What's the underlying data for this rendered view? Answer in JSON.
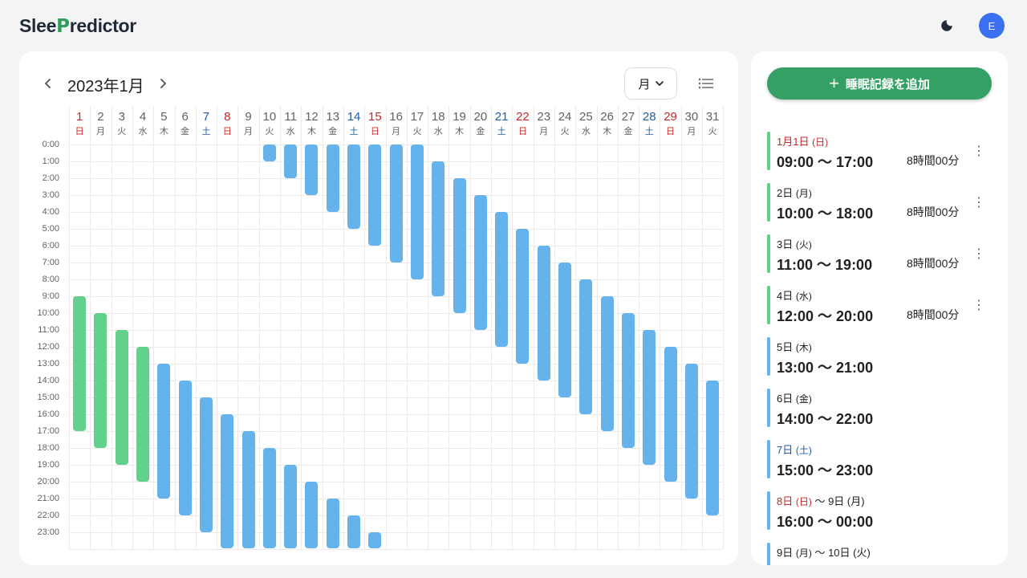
{
  "app": {
    "logo_prefix": "Slee",
    "logo_p": "P",
    "logo_suffix": "redictor",
    "avatar_initial": "E",
    "theme_icon": "moon-icon"
  },
  "calendar": {
    "month_title": "2023年1月",
    "view_label": "月",
    "days": [
      {
        "d": "1",
        "w": "日"
      },
      {
        "d": "2",
        "w": "月"
      },
      {
        "d": "3",
        "w": "火"
      },
      {
        "d": "4",
        "w": "水"
      },
      {
        "d": "5",
        "w": "木"
      },
      {
        "d": "6",
        "w": "金"
      },
      {
        "d": "7",
        "w": "土"
      },
      {
        "d": "8",
        "w": "日"
      },
      {
        "d": "9",
        "w": "月"
      },
      {
        "d": "10",
        "w": "火"
      },
      {
        "d": "11",
        "w": "水"
      },
      {
        "d": "12",
        "w": "木"
      },
      {
        "d": "13",
        "w": "金"
      },
      {
        "d": "14",
        "w": "土"
      },
      {
        "d": "15",
        "w": "日"
      },
      {
        "d": "16",
        "w": "月"
      },
      {
        "d": "17",
        "w": "火"
      },
      {
        "d": "18",
        "w": "水"
      },
      {
        "d": "19",
        "w": "木"
      },
      {
        "d": "20",
        "w": "金"
      },
      {
        "d": "21",
        "w": "土"
      },
      {
        "d": "22",
        "w": "日"
      },
      {
        "d": "23",
        "w": "月"
      },
      {
        "d": "24",
        "w": "火"
      },
      {
        "d": "25",
        "w": "水"
      },
      {
        "d": "26",
        "w": "木"
      },
      {
        "d": "27",
        "w": "金"
      },
      {
        "d": "28",
        "w": "土"
      },
      {
        "d": "29",
        "w": "日"
      },
      {
        "d": "30",
        "w": "月"
      },
      {
        "d": "31",
        "w": "火"
      }
    ],
    "hours": [
      "0:00",
      "1:00",
      "2:00",
      "3:00",
      "4:00",
      "5:00",
      "6:00",
      "7:00",
      "8:00",
      "9:00",
      "10:00",
      "11:00",
      "12:00",
      "13:00",
      "14:00",
      "15:00",
      "16:00",
      "17:00",
      "18:00",
      "19:00",
      "20:00",
      "21:00",
      "22:00",
      "23:00"
    ],
    "sleep_segments": [
      {
        "day": 1,
        "start": 9,
        "end": 17,
        "kind": "recorded"
      },
      {
        "day": 2,
        "start": 10,
        "end": 18,
        "kind": "recorded"
      },
      {
        "day": 3,
        "start": 11,
        "end": 19,
        "kind": "recorded"
      },
      {
        "day": 4,
        "start": 12,
        "end": 20,
        "kind": "recorded"
      },
      {
        "day": 5,
        "start": 13,
        "end": 21,
        "kind": "predicted"
      },
      {
        "day": 6,
        "start": 14,
        "end": 22,
        "kind": "predicted"
      },
      {
        "day": 7,
        "start": 15,
        "end": 23,
        "kind": "predicted"
      },
      {
        "day": 8,
        "start": 16,
        "end": 24,
        "kind": "predicted"
      },
      {
        "day": 9,
        "start": 17,
        "end": 24,
        "kind": "predicted"
      },
      {
        "day": 10,
        "start": 0,
        "end": 1,
        "kind": "predicted"
      },
      {
        "day": 10,
        "start": 18,
        "end": 24,
        "kind": "predicted"
      },
      {
        "day": 11,
        "start": 0,
        "end": 2,
        "kind": "predicted"
      },
      {
        "day": 11,
        "start": 19,
        "end": 24,
        "kind": "predicted"
      },
      {
        "day": 12,
        "start": 0,
        "end": 3,
        "kind": "predicted"
      },
      {
        "day": 12,
        "start": 20,
        "end": 24,
        "kind": "predicted"
      },
      {
        "day": 13,
        "start": 0,
        "end": 4,
        "kind": "predicted"
      },
      {
        "day": 13,
        "start": 21,
        "end": 24,
        "kind": "predicted"
      },
      {
        "day": 14,
        "start": 0,
        "end": 5,
        "kind": "predicted"
      },
      {
        "day": 14,
        "start": 22,
        "end": 24,
        "kind": "predicted"
      },
      {
        "day": 15,
        "start": 0,
        "end": 6,
        "kind": "predicted"
      },
      {
        "day": 15,
        "start": 23,
        "end": 24,
        "kind": "predicted"
      },
      {
        "day": 16,
        "start": 0,
        "end": 7,
        "kind": "predicted"
      },
      {
        "day": 17,
        "start": 0,
        "end": 8,
        "kind": "predicted"
      },
      {
        "day": 18,
        "start": 1,
        "end": 9,
        "kind": "predicted"
      },
      {
        "day": 19,
        "start": 2,
        "end": 10,
        "kind": "predicted"
      },
      {
        "day": 20,
        "start": 3,
        "end": 11,
        "kind": "predicted"
      },
      {
        "day": 21,
        "start": 4,
        "end": 12,
        "kind": "predicted"
      },
      {
        "day": 22,
        "start": 5,
        "end": 13,
        "kind": "predicted"
      },
      {
        "day": 23,
        "start": 6,
        "end": 14,
        "kind": "predicted"
      },
      {
        "day": 24,
        "start": 7,
        "end": 15,
        "kind": "predicted"
      },
      {
        "day": 25,
        "start": 8,
        "end": 16,
        "kind": "predicted"
      },
      {
        "day": 26,
        "start": 9,
        "end": 17,
        "kind": "predicted"
      },
      {
        "day": 27,
        "start": 10,
        "end": 18,
        "kind": "predicted"
      },
      {
        "day": 28,
        "start": 11,
        "end": 19,
        "kind": "predicted"
      },
      {
        "day": 29,
        "start": 12,
        "end": 20,
        "kind": "predicted"
      },
      {
        "day": 30,
        "start": 13,
        "end": 21,
        "kind": "predicted"
      },
      {
        "day": 31,
        "start": 14,
        "end": 22,
        "kind": "predicted"
      }
    ]
  },
  "sidebar": {
    "add_button_label": "睡眠記録を追加",
    "records": [
      {
        "date": "1月1日",
        "dow": "(日)",
        "rest": "",
        "time": "09:00 〜 17:00",
        "duration": "8時間00分",
        "kind": "recorded",
        "tone": "sun"
      },
      {
        "date": "2日",
        "dow": "(月)",
        "rest": "",
        "time": "10:00 〜 18:00",
        "duration": "8時間00分",
        "kind": "recorded",
        "tone": "normal"
      },
      {
        "date": "3日",
        "dow": "(火)",
        "rest": "",
        "time": "11:00 〜 19:00",
        "duration": "8時間00分",
        "kind": "recorded",
        "tone": "normal"
      },
      {
        "date": "4日",
        "dow": "(水)",
        "rest": "",
        "time": "12:00 〜 20:00",
        "duration": "8時間00分",
        "kind": "recorded",
        "tone": "normal"
      },
      {
        "date": "5日",
        "dow": "(木)",
        "rest": "",
        "time": "13:00 〜 21:00",
        "duration": "",
        "kind": "predicted",
        "tone": "normal"
      },
      {
        "date": "6日",
        "dow": "(金)",
        "rest": "",
        "time": "14:00 〜 22:00",
        "duration": "",
        "kind": "predicted",
        "tone": "normal"
      },
      {
        "date": "7日",
        "dow": "(土)",
        "rest": "",
        "time": "15:00 〜 23:00",
        "duration": "",
        "kind": "predicted",
        "tone": "sat"
      },
      {
        "date": "8日",
        "dow": "(日)",
        "rest": " 〜 9日 (月)",
        "time": "16:00 〜 00:00",
        "duration": "",
        "kind": "predicted",
        "tone": "sun"
      },
      {
        "date": "9日",
        "dow": "(月)",
        "rest": " 〜 10日 (火)",
        "time": "",
        "duration": "",
        "kind": "predicted",
        "tone": "normal"
      }
    ]
  },
  "colors": {
    "recorded": "#63d08b",
    "predicted": "#64b3ec",
    "sunday": "#c62828",
    "saturday": "#1e5aa8",
    "accent": "#34a064"
  }
}
